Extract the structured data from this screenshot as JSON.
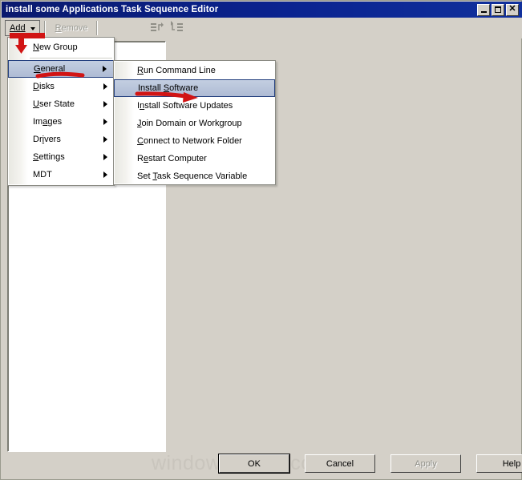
{
  "window": {
    "title": "install some Applications Task Sequence Editor",
    "controls": {
      "minimize": "–",
      "maximize": "□",
      "close": "✕"
    }
  },
  "toolbar": {
    "add_label": "Add",
    "add_accel": "A",
    "remove_label": "Remove",
    "remove_accel": "R",
    "icon_move_up": "move-up-icon",
    "icon_move_down": "move-down-icon"
  },
  "menus": {
    "add_menu": {
      "name": "add-dropdown-menu",
      "items": [
        {
          "label": "New Group",
          "accel": "N",
          "submenu": false,
          "selected": false,
          "separator_after": true
        },
        {
          "label": "General",
          "accel": "G",
          "submenu": true,
          "selected": true,
          "separator_after": false
        },
        {
          "label": "Disks",
          "accel": "D",
          "submenu": true,
          "selected": false,
          "separator_after": false
        },
        {
          "label": "User State",
          "accel": "U",
          "submenu": true,
          "selected": false,
          "separator_after": false
        },
        {
          "label": "Images",
          "accel": "a",
          "submenu": true,
          "selected": false,
          "separator_after": false
        },
        {
          "label": "Drivers",
          "accel": "i",
          "submenu": true,
          "selected": false,
          "separator_after": false
        },
        {
          "label": "Settings",
          "accel": "S",
          "submenu": true,
          "selected": false,
          "separator_after": false
        },
        {
          "label": "MDT",
          "accel": "",
          "submenu": true,
          "selected": false,
          "separator_after": false
        }
      ]
    },
    "general_submenu": {
      "name": "general-submenu",
      "items": [
        {
          "label": "Run Command Line",
          "accel": "R",
          "selected": false
        },
        {
          "label": "Install Software",
          "accel": "S",
          "selected": true
        },
        {
          "label": "Install Software Updates",
          "accel": "n",
          "selected": false
        },
        {
          "label": "Join Domain or Workgroup",
          "accel": "J",
          "selected": false
        },
        {
          "label": "Connect to Network Folder",
          "accel": "C",
          "selected": false
        },
        {
          "label": "Restart Computer",
          "accel": "e",
          "selected": false
        },
        {
          "label": "Set Task Sequence Variable",
          "accel": "T",
          "selected": false
        }
      ]
    }
  },
  "tree_panel": {
    "name": "task-sequence-tree",
    "items": []
  },
  "footer": {
    "buttons": [
      {
        "label": "OK",
        "state": "default"
      },
      {
        "label": "Cancel",
        "state": "normal"
      },
      {
        "label": "Apply",
        "state": "disabled"
      },
      {
        "label": "Help",
        "state": "normal"
      }
    ]
  },
  "watermark": {
    "text": "windows-noob.com"
  },
  "annotations": {
    "color": "#d11414",
    "items": [
      {
        "name": "add-button-arrow",
        "kind": "bar-with-down-arrow"
      },
      {
        "name": "general-underline",
        "kind": "underline-stroke"
      },
      {
        "name": "install-software-arrow",
        "kind": "underline-right-arrow"
      }
    ]
  },
  "colors": {
    "title_bar": "#0a2390",
    "window_face": "#d4d0c8",
    "menu_face": "#ffffff",
    "selection": "#b8c4da",
    "selection_border": "#24407f",
    "annotation_red": "#d11414",
    "watermark_gray": "#c9c5bd"
  }
}
